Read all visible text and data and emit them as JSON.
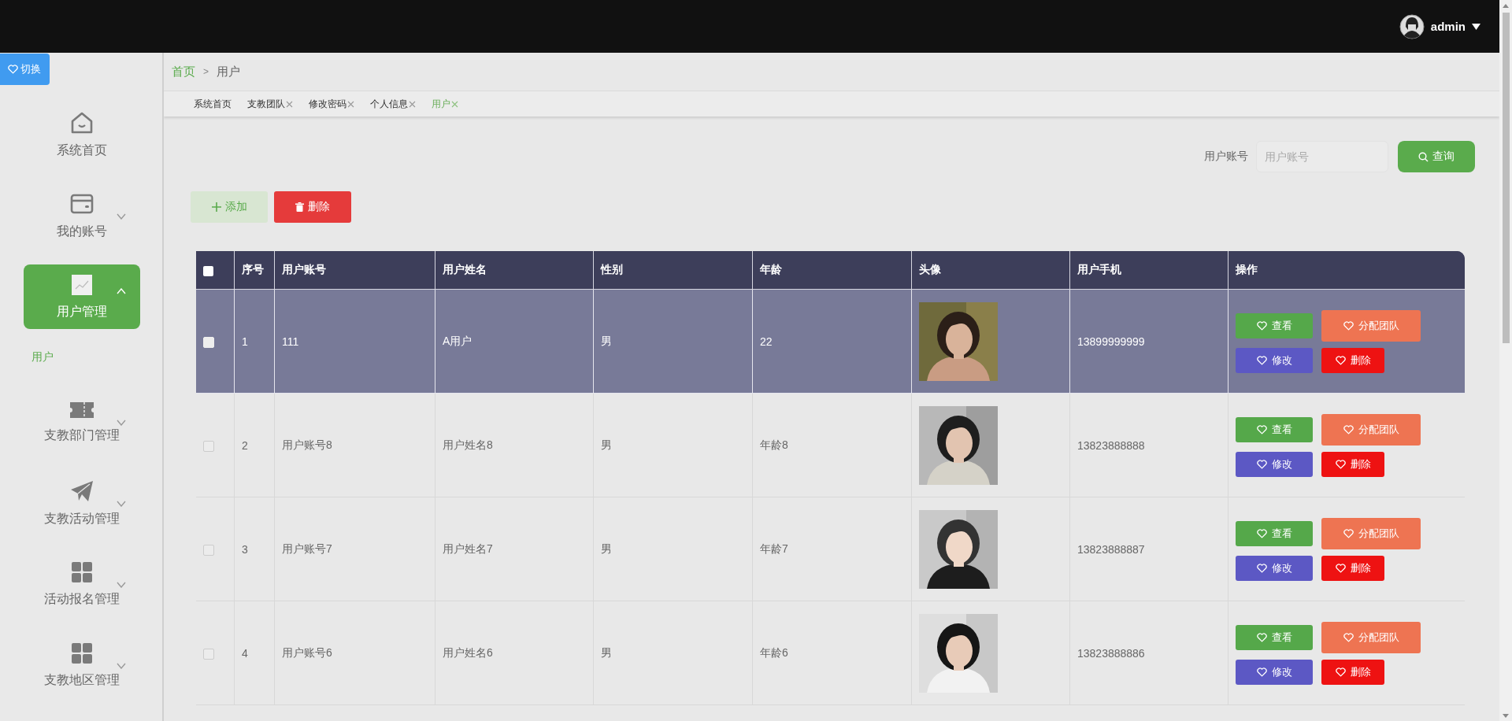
{
  "topbar": {
    "user": "admin"
  },
  "sidebar": {
    "toggle": "切换",
    "items": [
      {
        "label": "系统首页",
        "has_children": false,
        "selected": false
      },
      {
        "label": "我的账号",
        "has_children": true,
        "expanded": false,
        "selected": false
      },
      {
        "label": "用户管理",
        "has_children": true,
        "expanded": true,
        "selected": true,
        "children": [
          {
            "label": "用户",
            "selected": true
          }
        ]
      },
      {
        "label": "支教部门管理",
        "has_children": true,
        "expanded": false,
        "selected": false
      },
      {
        "label": "支教活动管理",
        "has_children": true,
        "expanded": false,
        "selected": false
      },
      {
        "label": "活动报名管理",
        "has_children": true,
        "expanded": false,
        "selected": false
      },
      {
        "label": "支教地区管理",
        "has_children": true,
        "expanded": false,
        "selected": false
      }
    ]
  },
  "breadcrumb": {
    "items": [
      "首页",
      "用户"
    ],
    "separator": ">"
  },
  "tabs": [
    {
      "label": "系统首页",
      "closable": false,
      "selected": false
    },
    {
      "label": "支教团队",
      "closable": true,
      "selected": false
    },
    {
      "label": "修改密码",
      "closable": true,
      "selected": false
    },
    {
      "label": "个人信息",
      "closable": true,
      "selected": false
    },
    {
      "label": "用户",
      "closable": true,
      "selected": true
    }
  ],
  "search": {
    "label": "用户账号",
    "placeholder": "用户账号",
    "button": "查询"
  },
  "toolbar": [
    {
      "label": "添加",
      "kind": "add"
    },
    {
      "label": "删除",
      "kind": "delete"
    }
  ],
  "table": {
    "header_checked": false,
    "columns": [
      "序号",
      "用户账号",
      "用户姓名",
      "性别",
      "年龄",
      "头像",
      "用户手机",
      "操作"
    ],
    "rows": [
      {
        "checked": false,
        "selected": true,
        "cells": [
          "1",
          "111",
          "A用户",
          "男",
          "22"
        ],
        "phone": "13899999999",
        "actions": [
          {
            "label": "查看",
            "kind": "view"
          },
          {
            "label": "分配团队",
            "kind": "assign"
          },
          {
            "label": "修改",
            "kind": "edit"
          },
          {
            "label": "删除",
            "kind": "delete"
          }
        ]
      },
      {
        "checked": false,
        "selected": false,
        "cells": [
          "2",
          "用户账号8",
          "用户姓名8",
          "男",
          "年龄8"
        ],
        "phone": "13823888888",
        "actions": [
          {
            "label": "查看",
            "kind": "view"
          },
          {
            "label": "分配团队",
            "kind": "assign"
          },
          {
            "label": "修改",
            "kind": "edit"
          },
          {
            "label": "删除",
            "kind": "delete"
          }
        ]
      },
      {
        "checked": false,
        "selected": false,
        "cells": [
          "3",
          "用户账号7",
          "用户姓名7",
          "男",
          "年龄7"
        ],
        "phone": "13823888887",
        "actions": [
          {
            "label": "查看",
            "kind": "view"
          },
          {
            "label": "分配团队",
            "kind": "assign"
          },
          {
            "label": "修改",
            "kind": "edit"
          },
          {
            "label": "删除",
            "kind": "delete"
          }
        ]
      },
      {
        "checked": false,
        "selected": false,
        "cells": [
          "4",
          "用户账号6",
          "用户姓名6",
          "男",
          "年龄6"
        ],
        "phone": "13823888886",
        "actions": [
          {
            "label": "查看",
            "kind": "view"
          },
          {
            "label": "分配团队",
            "kind": "assign"
          },
          {
            "label": "修改",
            "kind": "edit"
          },
          {
            "label": "删除",
            "kind": "delete"
          }
        ]
      }
    ]
  }
}
